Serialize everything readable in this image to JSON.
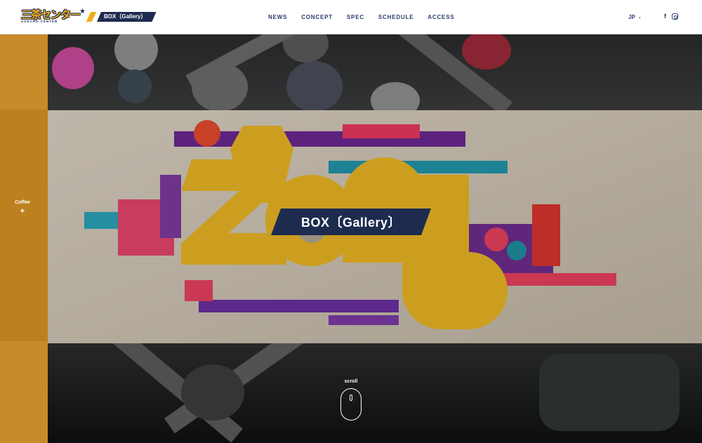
{
  "header": {
    "logo_text": "三茶センター",
    "logo_subtext": "SANCHA-CENTER",
    "logo_badge": "BOX（Gallery）",
    "nav": [
      "NEWS",
      "CONCEPT",
      "SPEC",
      "SCHEDULE",
      "ACCESS"
    ],
    "lang": "JP",
    "social": {
      "facebook": "f"
    }
  },
  "sidebar": {
    "label": "Coffee",
    "plus": "+"
  },
  "hero": {
    "title": "BOX〔Gallery〕",
    "scroll_label": "scroll"
  },
  "colors": {
    "navy": "#1d2b4f",
    "gold": "#c98a2a",
    "accent_yellow": "#e9b425"
  },
  "icons": [
    "chevron-down-icon",
    "facebook-icon",
    "instagram-icon",
    "mouse-scroll-icon",
    "plus-icon"
  ]
}
